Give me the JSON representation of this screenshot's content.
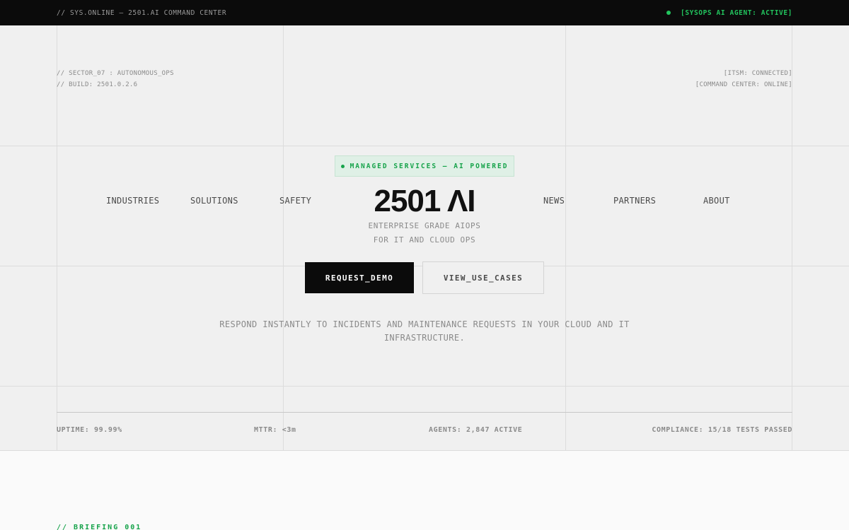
{
  "topbar": {
    "left_text": "// SYS.ONLINE — 2501.AI COMMAND CENTER",
    "status_text": "[SYSOPS AI AGENT: ACTIVE]"
  },
  "meta_left": {
    "line1": "// SECTOR_07 : AUTONOMOUS_OPS",
    "line2": "// BUILD: 2501.0.2.6"
  },
  "meta_right": {
    "line1": "[ITSM: CONNECTED]",
    "line2": "[COMMAND CENTER: ONLINE]"
  },
  "badge": {
    "label": "MANAGED SERVICES — AI POWERED"
  },
  "nav": {
    "industries": "INDUSTRIES",
    "solutions": "SOLUTIONS",
    "safety": "SAFETY",
    "news": "NEWS",
    "partners": "PARTNERS",
    "about": "ABOUT"
  },
  "logo": {
    "text": "2501 ΛI"
  },
  "tagline": {
    "line1": "ENTERPRISE GRADE AIOPS",
    "line2": "FOR IT AND CLOUD OPS"
  },
  "buttons": {
    "primary": "REQUEST_DEMO",
    "secondary": "VIEW_USE_CASES"
  },
  "description": "RESPOND INSTANTLY TO INCIDENTS AND MAINTENANCE REQUESTS IN YOUR CLOUD AND IT INFRASTRUCTURE.",
  "stats": {
    "uptime": "UPTIME: 99.99%",
    "mttr": "MTTR: <3m",
    "agents": "AGENTS: 2,847 ACTIVE",
    "compliance": "COMPLIANCE: 15/18 TESTS PASSED"
  },
  "briefing": {
    "label": "// BRIEFING 001"
  },
  "colors": {
    "accent": "#16a34a",
    "status_green": "#22c55e",
    "topbar_bg": "#0b0b0b",
    "page_bg": "#f0f0f0"
  }
}
